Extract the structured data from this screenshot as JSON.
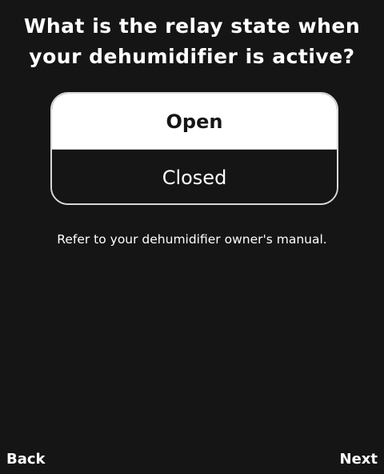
{
  "question": {
    "line1": "What is the relay state when",
    "line2": "your dehumidifier is active?"
  },
  "options": [
    {
      "label": "Open",
      "selected": true
    },
    {
      "label": "Closed",
      "selected": false
    }
  ],
  "hint": "Refer to your dehumidifier owner's manual.",
  "nav": {
    "back_label": "Back",
    "next_label": "Next"
  },
  "colors": {
    "background": "#151515",
    "selected_bg": "#ffffff",
    "text": "#ffffff"
  }
}
